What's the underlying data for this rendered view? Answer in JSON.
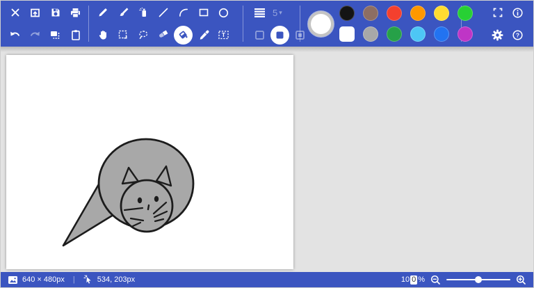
{
  "app_title": "Paint drawing application",
  "toolbar": {
    "row1_group_file": [
      {
        "name": "close"
      },
      {
        "name": "open"
      },
      {
        "name": "save"
      },
      {
        "name": "print"
      }
    ],
    "row1_group_tools": [
      {
        "name": "pencil"
      },
      {
        "name": "brush"
      },
      {
        "name": "spray"
      },
      {
        "name": "line"
      },
      {
        "name": "curve"
      },
      {
        "name": "rectangle"
      },
      {
        "name": "ellipse"
      }
    ],
    "line_width": {
      "value": "5",
      "caret": "▾",
      "disabled": true
    },
    "row2_group_edit": [
      {
        "name": "undo"
      },
      {
        "name": "redo",
        "disabled": true
      },
      {
        "name": "resize"
      },
      {
        "name": "paste"
      }
    ],
    "row2_group_tools": [
      {
        "name": "pan-hand"
      },
      {
        "name": "select-rect"
      },
      {
        "name": "select-lasso"
      },
      {
        "name": "eraser"
      },
      {
        "name": "fill",
        "selected": true
      },
      {
        "name": "eyedropper"
      },
      {
        "name": "text"
      }
    ],
    "shape_styles": [
      {
        "name": "style-outline"
      },
      {
        "name": "style-filled",
        "selected": true
      },
      {
        "name": "style-outline-filled"
      }
    ],
    "colors": {
      "current": "#ffffff",
      "selected": "white",
      "row1": [
        "#141414",
        "#8d6e63",
        "#f4402e",
        "#ff9800",
        "#fedc31",
        "#27d034"
      ],
      "row2": [
        "#ffffff",
        "#a8a8a8",
        "#26a148",
        "#4dc6f5",
        "#2273f1",
        "#bf35c6"
      ]
    },
    "row1_group_app": [
      {
        "name": "fullscreen"
      },
      {
        "name": "info"
      }
    ],
    "row2_group_app": [
      {
        "name": "settings"
      },
      {
        "name": "help"
      }
    ],
    "text_tool_letter": "T"
  },
  "canvas": {
    "drawing_name": "cat drawing",
    "fill_color": "#a8a8a8",
    "stroke_color": "#1c1c1c"
  },
  "statusbar": {
    "canvas_size": "640 × 480px",
    "separator": "|",
    "cursor_position": "534, 203px",
    "zoom_prefix": "10",
    "zoom_boxed_digit": "0",
    "zoom_unit": "%",
    "zoom_slider_percent": 50
  }
}
